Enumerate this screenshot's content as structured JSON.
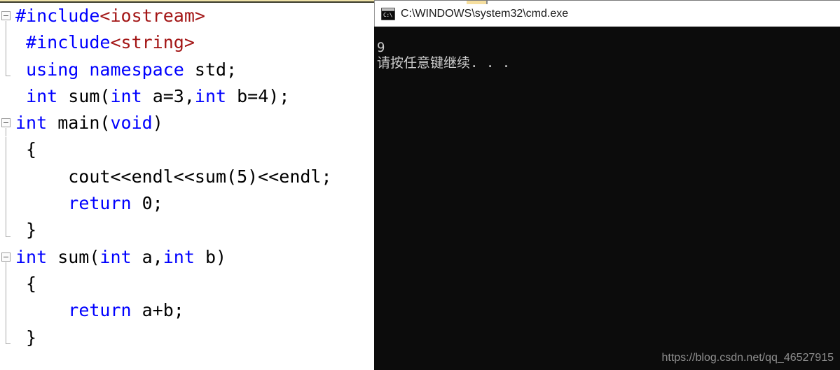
{
  "editor": {
    "name": "code-editor-pane",
    "language": "C++",
    "colors": {
      "keyword": "#0000ff",
      "header_string": "#a31515",
      "plain_text": "#000000",
      "background": "#ffffff",
      "fold_guide": "#a9a9a9"
    },
    "lines": [
      {
        "fold": "open",
        "guide": "start",
        "segments": [
          {
            "t": "#include",
            "c": "kw"
          },
          {
            "t": "<iostream>",
            "c": "hdr"
          }
        ]
      },
      {
        "fold": "none",
        "guide": "middle",
        "segments": [
          {
            "t": " #include",
            "c": "kw"
          },
          {
            "t": "<string>",
            "c": "hdr"
          }
        ]
      },
      {
        "fold": "none",
        "guide": "end",
        "segments": [
          {
            "t": " ",
            "c": "plain"
          },
          {
            "t": "using namespace",
            "c": "kw"
          },
          {
            "t": " std;",
            "c": "plain"
          }
        ]
      },
      {
        "fold": "none",
        "guide": "none",
        "segments": [
          {
            "t": " ",
            "c": "plain"
          },
          {
            "t": "int",
            "c": "kw"
          },
          {
            "t": " sum(",
            "c": "plain"
          },
          {
            "t": "int",
            "c": "kw"
          },
          {
            "t": " a=3,",
            "c": "plain"
          },
          {
            "t": "int",
            "c": "kw"
          },
          {
            "t": " b=4);",
            "c": "plain"
          }
        ]
      },
      {
        "fold": "open",
        "guide": "start",
        "segments": [
          {
            "t": "int",
            "c": "kw"
          },
          {
            "t": " main(",
            "c": "plain"
          },
          {
            "t": "void",
            "c": "kw"
          },
          {
            "t": ")",
            "c": "plain"
          }
        ]
      },
      {
        "fold": "none",
        "guide": "middle",
        "segments": [
          {
            "t": " {",
            "c": "plain"
          }
        ]
      },
      {
        "fold": "none",
        "guide": "middle",
        "segments": [
          {
            "t": "     cout<<endl<<sum(5)<<endl;",
            "c": "plain"
          }
        ]
      },
      {
        "fold": "none",
        "guide": "middle",
        "segments": [
          {
            "t": "     ",
            "c": "plain"
          },
          {
            "t": "return",
            "c": "kw"
          },
          {
            "t": " 0;",
            "c": "plain"
          }
        ]
      },
      {
        "fold": "none",
        "guide": "end",
        "segments": [
          {
            "t": " }",
            "c": "plain"
          }
        ]
      },
      {
        "fold": "open",
        "guide": "start",
        "segments": [
          {
            "t": "int",
            "c": "kw"
          },
          {
            "t": " sum(",
            "c": "plain"
          },
          {
            "t": "int",
            "c": "kw"
          },
          {
            "t": " a,",
            "c": "plain"
          },
          {
            "t": "int",
            "c": "kw"
          },
          {
            "t": " b)",
            "c": "plain"
          }
        ]
      },
      {
        "fold": "none",
        "guide": "middle",
        "segments": [
          {
            "t": " {",
            "c": "plain"
          }
        ]
      },
      {
        "fold": "none",
        "guide": "middle",
        "segments": [
          {
            "t": "     ",
            "c": "plain"
          },
          {
            "t": "return",
            "c": "kw"
          },
          {
            "t": " a+b;",
            "c": "plain"
          }
        ]
      },
      {
        "fold": "none",
        "guide": "end",
        "segments": [
          {
            "t": " }",
            "c": "plain"
          }
        ]
      }
    ]
  },
  "console": {
    "title": "C:\\WINDOWS\\system32\\cmd.exe",
    "icon": "cmd-console-icon",
    "icon_glyph": "C:\\",
    "background": "#0c0c0c",
    "text_color": "#cccccc",
    "output": [
      "9",
      "请按任意键继续. . ."
    ],
    "cursor": "block",
    "watermark": "https://blog.csdn.net/qq_46527915"
  }
}
